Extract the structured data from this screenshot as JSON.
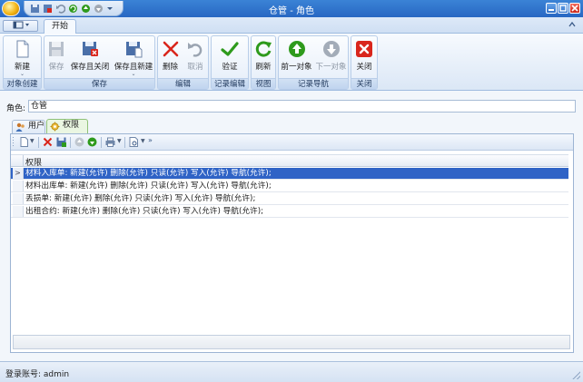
{
  "window": {
    "title": "仓管 - 角色"
  },
  "ribbon_tabs": {
    "active": "开始"
  },
  "ribbon": {
    "groups": [
      {
        "label": "对象创建"
      },
      {
        "label": "保存"
      },
      {
        "label": "编辑"
      },
      {
        "label": "记录编辑"
      },
      {
        "label": "视图"
      },
      {
        "label": "记录导航"
      },
      {
        "label": "关闭"
      }
    ],
    "buttons": {
      "new": "新建",
      "save": "保存",
      "save_close": "保存且关闭",
      "save_new": "保存且新建",
      "delete": "删除",
      "cancel": "取消",
      "validate": "验证",
      "refresh": "刷新",
      "prev": "前一对象",
      "next": "下一对象",
      "close": "关闭"
    }
  },
  "form": {
    "role_label": "角色:",
    "role_value": "仓管"
  },
  "subtabs": [
    {
      "label": "用户"
    },
    {
      "label": "权限"
    }
  ],
  "grid": {
    "column": "权限",
    "rows": [
      "材料入库单: 新建(允许) 删除(允许) 只读(允许) 写入(允许) 导航(允许);",
      "材料出库单: 新建(允许) 删除(允许) 只读(允许) 写入(允许) 导航(允许);",
      "丢损单: 新建(允许) 删除(允许) 只读(允许) 写入(允许) 导航(允许);",
      "出租合约: 新建(允许) 删除(允许) 只读(允许) 写入(允许) 导航(允许);"
    ],
    "selected_index": 0
  },
  "status": {
    "text": "登录账号: admin"
  },
  "colors": {
    "title_bar": "#2867c3",
    "selection": "#2f63c6",
    "delete_red": "#d9261c",
    "validate_green": "#2e9a1c"
  }
}
